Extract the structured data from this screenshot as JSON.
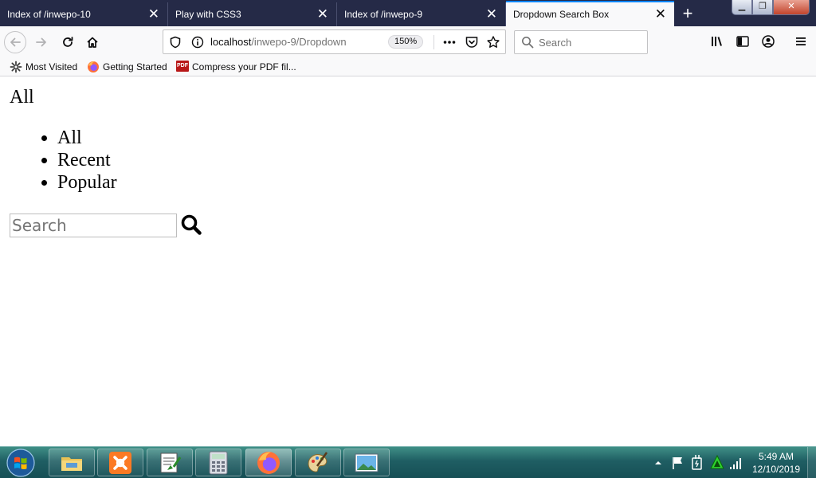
{
  "browser": {
    "tabs": [
      {
        "title": "Index of /inwepo-10",
        "active": false
      },
      {
        "title": "Play with CSS3",
        "active": false
      },
      {
        "title": "Index of /inwepo-9",
        "active": false
      },
      {
        "title": "Dropdown Search Box",
        "active": true
      }
    ],
    "new_tab_icon": "plus-icon",
    "url": {
      "host": "localhost",
      "path": "/inwepo-9/Dropdown"
    },
    "zoom": "150%",
    "search_placeholder": "Search",
    "accent_color": "#0a84ff"
  },
  "bookmarks": [
    {
      "label": "Most Visited",
      "icon": "gear-icon"
    },
    {
      "label": "Getting Started",
      "icon": "firefox-icon"
    },
    {
      "label": "Compress your PDF fil...",
      "icon": "pdf-icon",
      "icon_text": "PDF"
    }
  ],
  "page": {
    "selected_filter": "All",
    "filter_options": [
      "All",
      "Recent",
      "Popular"
    ],
    "search_placeholder": "Search"
  },
  "taskbar": {
    "apps": [
      "file-explorer-icon",
      "xampp-icon",
      "notepad-icon",
      "calculator-icon",
      "firefox-icon",
      "paint-icon",
      "photo-viewer-icon"
    ],
    "active_app": "firefox-icon",
    "time": "5:49 AM",
    "date": "12/10/2019"
  }
}
